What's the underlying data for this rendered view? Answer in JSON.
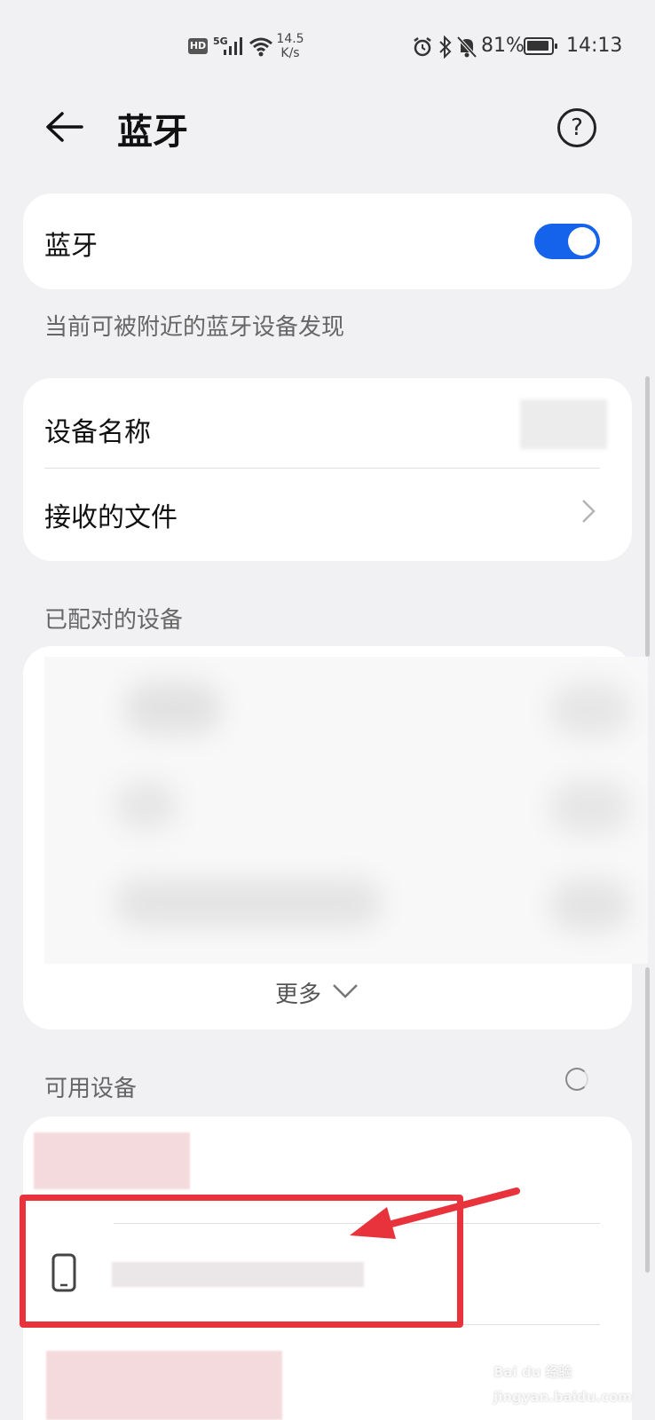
{
  "status_bar": {
    "hd": "HD",
    "network": "5G",
    "speed_value": "14.5",
    "speed_unit": "K/s",
    "battery": "81%",
    "time": "14:13"
  },
  "header": {
    "title": "蓝牙"
  },
  "bluetooth_toggle": {
    "label": "蓝牙",
    "enabled": true,
    "accent_color": "#1463ea"
  },
  "visibility_note": "当前可被附近的蓝牙设备发现",
  "settings": {
    "device_name_label": "设备名称",
    "received_files_label": "接收的文件"
  },
  "paired_devices": {
    "section_label": "已配对的设备",
    "more_label": "更多"
  },
  "available_devices": {
    "section_label": "可用设备"
  },
  "annotation_color": "#e8333d",
  "watermark": "Bai du 经验 jingyan.baidu.com"
}
